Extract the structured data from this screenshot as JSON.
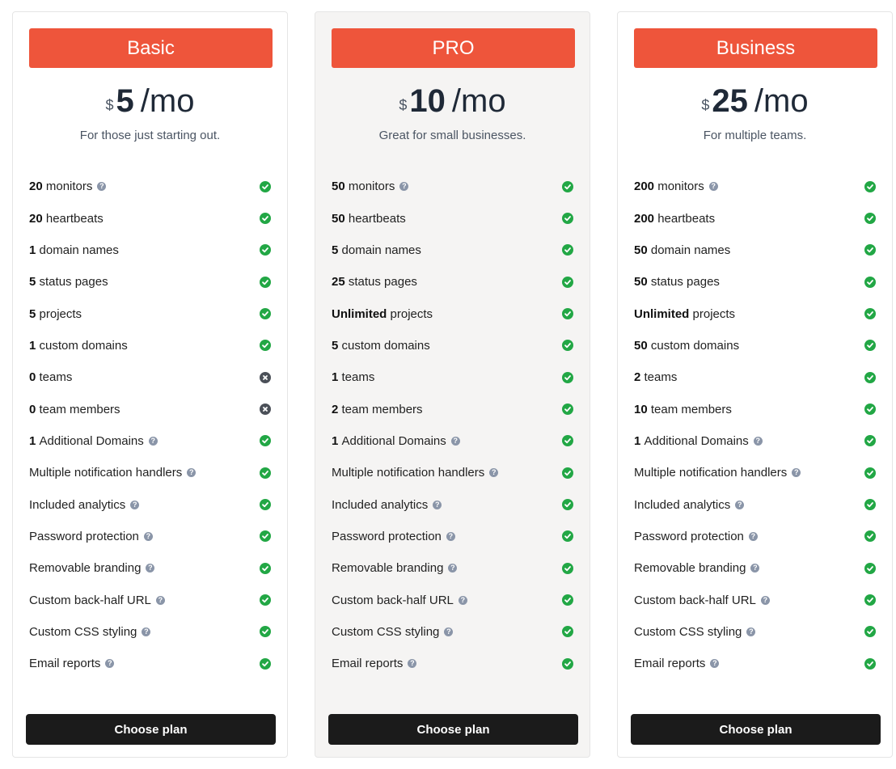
{
  "icons": {
    "help": "question-circle-icon",
    "included": "check-circle-icon",
    "excluded": "times-circle-icon"
  },
  "colors": {
    "accent": "#ee553b",
    "check": "#22a745",
    "cross": "#4b5058",
    "button": "#1b1b1b",
    "featured_bg": "#f5f4f3"
  },
  "plans": [
    {
      "name": "Basic",
      "currency": "$",
      "amount": "5",
      "period": "/mo",
      "tagline": "For those just starting out.",
      "button": "Choose plan",
      "features": [
        {
          "value": "20",
          "label": "monitors",
          "help": true,
          "included": true
        },
        {
          "value": "20",
          "label": "heartbeats",
          "help": false,
          "included": true
        },
        {
          "value": "1",
          "label": "domain names",
          "help": false,
          "included": true
        },
        {
          "value": "5",
          "label": "status pages",
          "help": false,
          "included": true
        },
        {
          "value": "5",
          "label": "projects",
          "help": false,
          "included": true
        },
        {
          "value": "1",
          "label": "custom domains",
          "help": false,
          "included": true
        },
        {
          "value": "0",
          "label": "teams",
          "help": false,
          "included": false
        },
        {
          "value": "0",
          "label": "team members",
          "help": false,
          "included": false
        },
        {
          "value": "1",
          "label": "Additional Domains",
          "help": true,
          "included": true
        },
        {
          "value": "",
          "label": "Multiple notification handlers",
          "help": true,
          "included": true
        },
        {
          "value": "",
          "label": "Included analytics",
          "help": true,
          "included": true
        },
        {
          "value": "",
          "label": "Password protection",
          "help": true,
          "included": true
        },
        {
          "value": "",
          "label": "Removable branding",
          "help": true,
          "included": true
        },
        {
          "value": "",
          "label": "Custom back-half URL",
          "help": true,
          "included": true
        },
        {
          "value": "",
          "label": "Custom CSS styling",
          "help": true,
          "included": true
        },
        {
          "value": "",
          "label": "Email reports",
          "help": true,
          "included": true
        }
      ]
    },
    {
      "name": "PRO",
      "currency": "$",
      "amount": "10",
      "period": "/mo",
      "tagline": "Great for small businesses.",
      "button": "Choose plan",
      "featured": true,
      "features": [
        {
          "value": "50",
          "label": "monitors",
          "help": true,
          "included": true
        },
        {
          "value": "50",
          "label": "heartbeats",
          "help": false,
          "included": true
        },
        {
          "value": "5",
          "label": "domain names",
          "help": false,
          "included": true
        },
        {
          "value": "25",
          "label": "status pages",
          "help": false,
          "included": true
        },
        {
          "value": "Unlimited",
          "label": "projects",
          "help": false,
          "included": true
        },
        {
          "value": "5",
          "label": "custom domains",
          "help": false,
          "included": true
        },
        {
          "value": "1",
          "label": "teams",
          "help": false,
          "included": true
        },
        {
          "value": "2",
          "label": "team members",
          "help": false,
          "included": true
        },
        {
          "value": "1",
          "label": "Additional Domains",
          "help": true,
          "included": true
        },
        {
          "value": "",
          "label": "Multiple notification handlers",
          "help": true,
          "included": true
        },
        {
          "value": "",
          "label": "Included analytics",
          "help": true,
          "included": true
        },
        {
          "value": "",
          "label": "Password protection",
          "help": true,
          "included": true
        },
        {
          "value": "",
          "label": "Removable branding",
          "help": true,
          "included": true
        },
        {
          "value": "",
          "label": "Custom back-half URL",
          "help": true,
          "included": true
        },
        {
          "value": "",
          "label": "Custom CSS styling",
          "help": true,
          "included": true
        },
        {
          "value": "",
          "label": "Email reports",
          "help": true,
          "included": true
        }
      ]
    },
    {
      "name": "Business",
      "currency": "$",
      "amount": "25",
      "period": "/mo",
      "tagline": "For multiple teams.",
      "button": "Choose plan",
      "features": [
        {
          "value": "200",
          "label": "monitors",
          "help": true,
          "included": true
        },
        {
          "value": "200",
          "label": "heartbeats",
          "help": false,
          "included": true
        },
        {
          "value": "50",
          "label": "domain names",
          "help": false,
          "included": true
        },
        {
          "value": "50",
          "label": "status pages",
          "help": false,
          "included": true
        },
        {
          "value": "Unlimited",
          "label": "projects",
          "help": false,
          "included": true
        },
        {
          "value": "50",
          "label": "custom domains",
          "help": false,
          "included": true
        },
        {
          "value": "2",
          "label": "teams",
          "help": false,
          "included": true
        },
        {
          "value": "10",
          "label": "team members",
          "help": false,
          "included": true
        },
        {
          "value": "1",
          "label": "Additional Domains",
          "help": true,
          "included": true
        },
        {
          "value": "",
          "label": "Multiple notification handlers",
          "help": true,
          "included": true
        },
        {
          "value": "",
          "label": "Included analytics",
          "help": true,
          "included": true
        },
        {
          "value": "",
          "label": "Password protection",
          "help": true,
          "included": true
        },
        {
          "value": "",
          "label": "Removable branding",
          "help": true,
          "included": true
        },
        {
          "value": "",
          "label": "Custom back-half URL",
          "help": true,
          "included": true
        },
        {
          "value": "",
          "label": "Custom CSS styling",
          "help": true,
          "included": true
        },
        {
          "value": "",
          "label": "Email reports",
          "help": true,
          "included": true
        }
      ]
    }
  ]
}
